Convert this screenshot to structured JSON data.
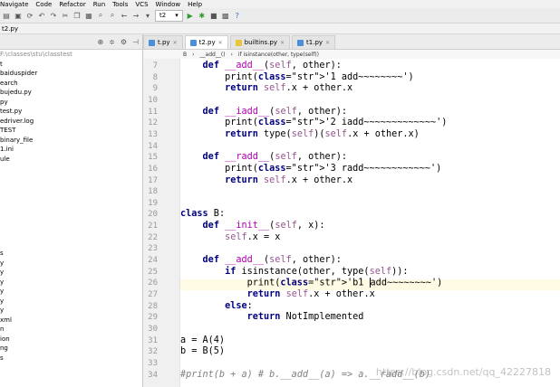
{
  "menu": [
    "Navigate",
    "Code",
    "Refactor",
    "Run",
    "Tools",
    "VCS",
    "Window",
    "Help"
  ],
  "toolbar": {
    "run_config": "t2"
  },
  "nav_file": "t2.py",
  "left_panel": {
    "path": "F:\\classes\\stu\\classtest",
    "items": [
      "t",
      "",
      "baiduspider",
      "earch",
      "bujedu.py",
      "py",
      "test.py",
      "edriver.log",
      "TEST",
      "binary_file",
      "1.ini",
      "ule"
    ],
    "lower_items": [
      "s",
      "y",
      "y",
      "y",
      "y",
      "y",
      "y",
      "xml",
      "n",
      "ion",
      "ng",
      "s"
    ]
  },
  "tabs": [
    {
      "label": "t.py",
      "active": false,
      "icon": "blue"
    },
    {
      "label": "t2.py",
      "active": true,
      "icon": "blue"
    },
    {
      "label": "builtins.py",
      "active": false,
      "icon": "yellow"
    },
    {
      "label": "t1.py",
      "active": false,
      "icon": "blue"
    }
  ],
  "breadcrumb": [
    "B",
    "__add__()",
    "if isinstance(other, type(self))"
  ],
  "code_lines": [
    {
      "n": 7,
      "text": "    def __add__(self, other):"
    },
    {
      "n": 8,
      "text": "        print('1 add~~~~~~~~')"
    },
    {
      "n": 9,
      "text": "        return self.x + other.x"
    },
    {
      "n": 10,
      "text": ""
    },
    {
      "n": 11,
      "text": "    def __iadd__(self, other):"
    },
    {
      "n": 12,
      "text": "        print('2 iadd~~~~~~~~~~~~~')"
    },
    {
      "n": 13,
      "text": "        return type(self)(self.x + other.x)"
    },
    {
      "n": 14,
      "text": ""
    },
    {
      "n": 15,
      "text": "    def __radd__(self, other):"
    },
    {
      "n": 16,
      "text": "        print('3 radd~~~~~~~~~~~~')"
    },
    {
      "n": 17,
      "text": "        return self.x + other.x"
    },
    {
      "n": 18,
      "text": ""
    },
    {
      "n": 19,
      "text": ""
    },
    {
      "n": 20,
      "text": "class B:"
    },
    {
      "n": 21,
      "text": "    def __init__(self, x):"
    },
    {
      "n": 22,
      "text": "        self.x = x"
    },
    {
      "n": 23,
      "text": ""
    },
    {
      "n": 24,
      "text": "    def __add__(self, other):"
    },
    {
      "n": 25,
      "text": "        if isinstance(other, type(self)):"
    },
    {
      "n": 26,
      "text": "            print('b1 add~~~~~~~~')"
    },
    {
      "n": 27,
      "text": "            return self.x + other.x"
    },
    {
      "n": 28,
      "text": "        else:"
    },
    {
      "n": 29,
      "text": "            return NotImplemented"
    },
    {
      "n": 30,
      "text": ""
    },
    {
      "n": 31,
      "text": "a = A(4)"
    },
    {
      "n": 32,
      "text": "b = B(5)"
    },
    {
      "n": 33,
      "text": ""
    },
    {
      "n": 34,
      "text": "#print(b + a) # b.__add__(a) => a.__radd__(b)"
    }
  ],
  "watermark": "https://blog.csdn.net/qq_42227818"
}
